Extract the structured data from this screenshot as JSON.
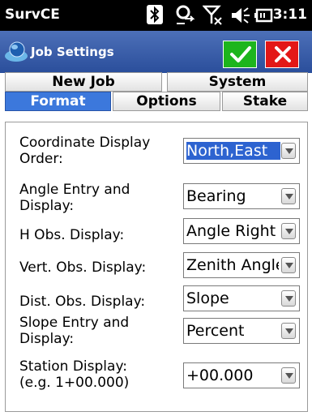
{
  "statusbar": {
    "app_title": "SurvCE",
    "time": "3:11",
    "icons": [
      "bluetooth-icon",
      "sync-icon",
      "no-signal-icon",
      "volume-icon",
      "battery-icon"
    ]
  },
  "titlebar": {
    "title": "Job Settings",
    "ok_icon": "checkmark-icon",
    "close_icon": "close-icon"
  },
  "tabs": {
    "row1": [
      "New Job",
      "System"
    ],
    "row2": [
      "Format",
      "Options",
      "Stake"
    ],
    "active": "Format"
  },
  "fields": [
    {
      "label": "Coordinate Display Order:",
      "value": "North,East"
    },
    {
      "label": "Angle Entry and Display:",
      "value": "Bearing"
    },
    {
      "label": "H Obs. Display:",
      "value": "Angle Right"
    },
    {
      "label": "Vert. Obs. Display:",
      "value": "Zenith Angle"
    },
    {
      "label": "Dist. Obs. Display:",
      "value": "Slope"
    },
    {
      "label": "Slope Entry and Display:",
      "value": "Percent"
    },
    {
      "label": "Station Display: (e.g. 1+00.000)",
      "value": "+00.000"
    }
  ],
  "colors": {
    "titlebar": "#2a4e9b",
    "active_tab": "#3c78dc",
    "ok_button": "#1db51d",
    "close_button": "#e31717",
    "selection": "#2d63d0"
  }
}
